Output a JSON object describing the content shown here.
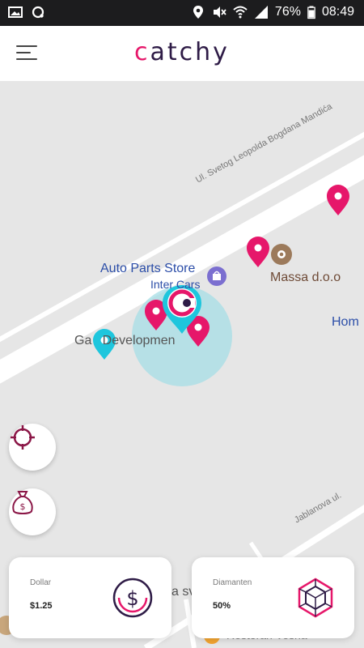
{
  "status_bar": {
    "battery": "76%",
    "time": "08:49",
    "icons": [
      "image-icon",
      "sync-icon",
      "location-icon",
      "mute-icon",
      "wifi-icon",
      "signal-icon",
      "battery-icon"
    ]
  },
  "header": {
    "logo_first": "c",
    "logo_rest": "atchy",
    "menu_icon": "hamburger-menu-icon"
  },
  "map": {
    "streets": {
      "main": "Ul. Svetog Leopolda Bogdana Mandića",
      "secondary": "Jablanova ul."
    },
    "pois": {
      "auto_parts": "Auto Parts Store",
      "inter_cars": "Inter Cars",
      "massa": "Massa d.o.o",
      "hom": "Hom",
      "ga_dev": "Ga   Developmen",
      "bottom_street": "a sv",
      "restoran": "Restoran Vesna"
    },
    "colors": {
      "pink": "#e6176a",
      "cyan": "#1ec6dd",
      "brown": "#9c7a5b"
    }
  },
  "buttons": {
    "locate": "crosshair-icon",
    "money": "money-bag-icon"
  },
  "cards": {
    "dollar": {
      "label": "Dollar",
      "value": "$1.25",
      "icon": "dollar-coin-icon"
    },
    "diamonds": {
      "label": "Diamanten",
      "value": "50%",
      "icon": "diamond-icon"
    }
  }
}
